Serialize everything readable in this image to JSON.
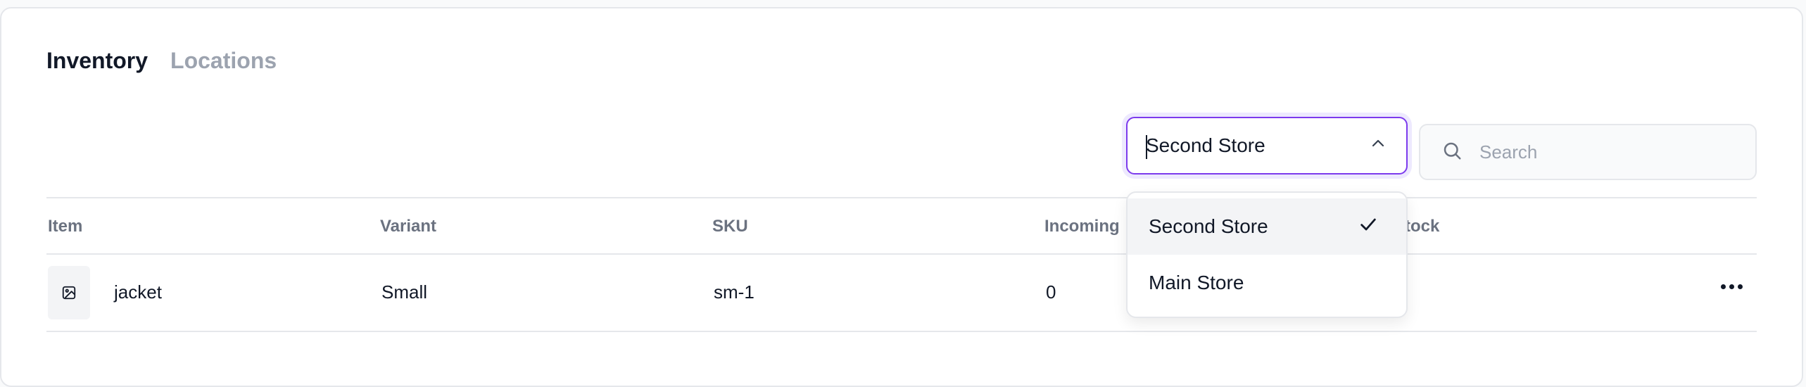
{
  "tabs": {
    "inventory": "Inventory",
    "locations": "Locations"
  },
  "filters": {
    "store_select": {
      "value": "Second Store",
      "options": [
        "Second Store",
        "Main Store"
      ],
      "selected_index": 0
    },
    "search": {
      "placeholder": "Search",
      "value": ""
    }
  },
  "table": {
    "columns": {
      "item": "Item",
      "variant": "Variant",
      "sku": "SKU",
      "incoming": "Incoming",
      "stock": "tock"
    },
    "rows": [
      {
        "item": "jacket",
        "variant": "Small",
        "sku": "sm-1",
        "incoming": "0"
      }
    ]
  },
  "icons": {
    "chevron": "chevron-up-icon",
    "search": "search-icon",
    "check": "check-icon",
    "thumbnail": "image-placeholder-icon",
    "more": "more-horizontal-icon"
  },
  "colors": {
    "accent": "#7c3aed",
    "accent_ring": "#ede9fe",
    "muted_text": "#9ca3af",
    "header_text": "#6b7280",
    "border": "#e5e7eb"
  }
}
